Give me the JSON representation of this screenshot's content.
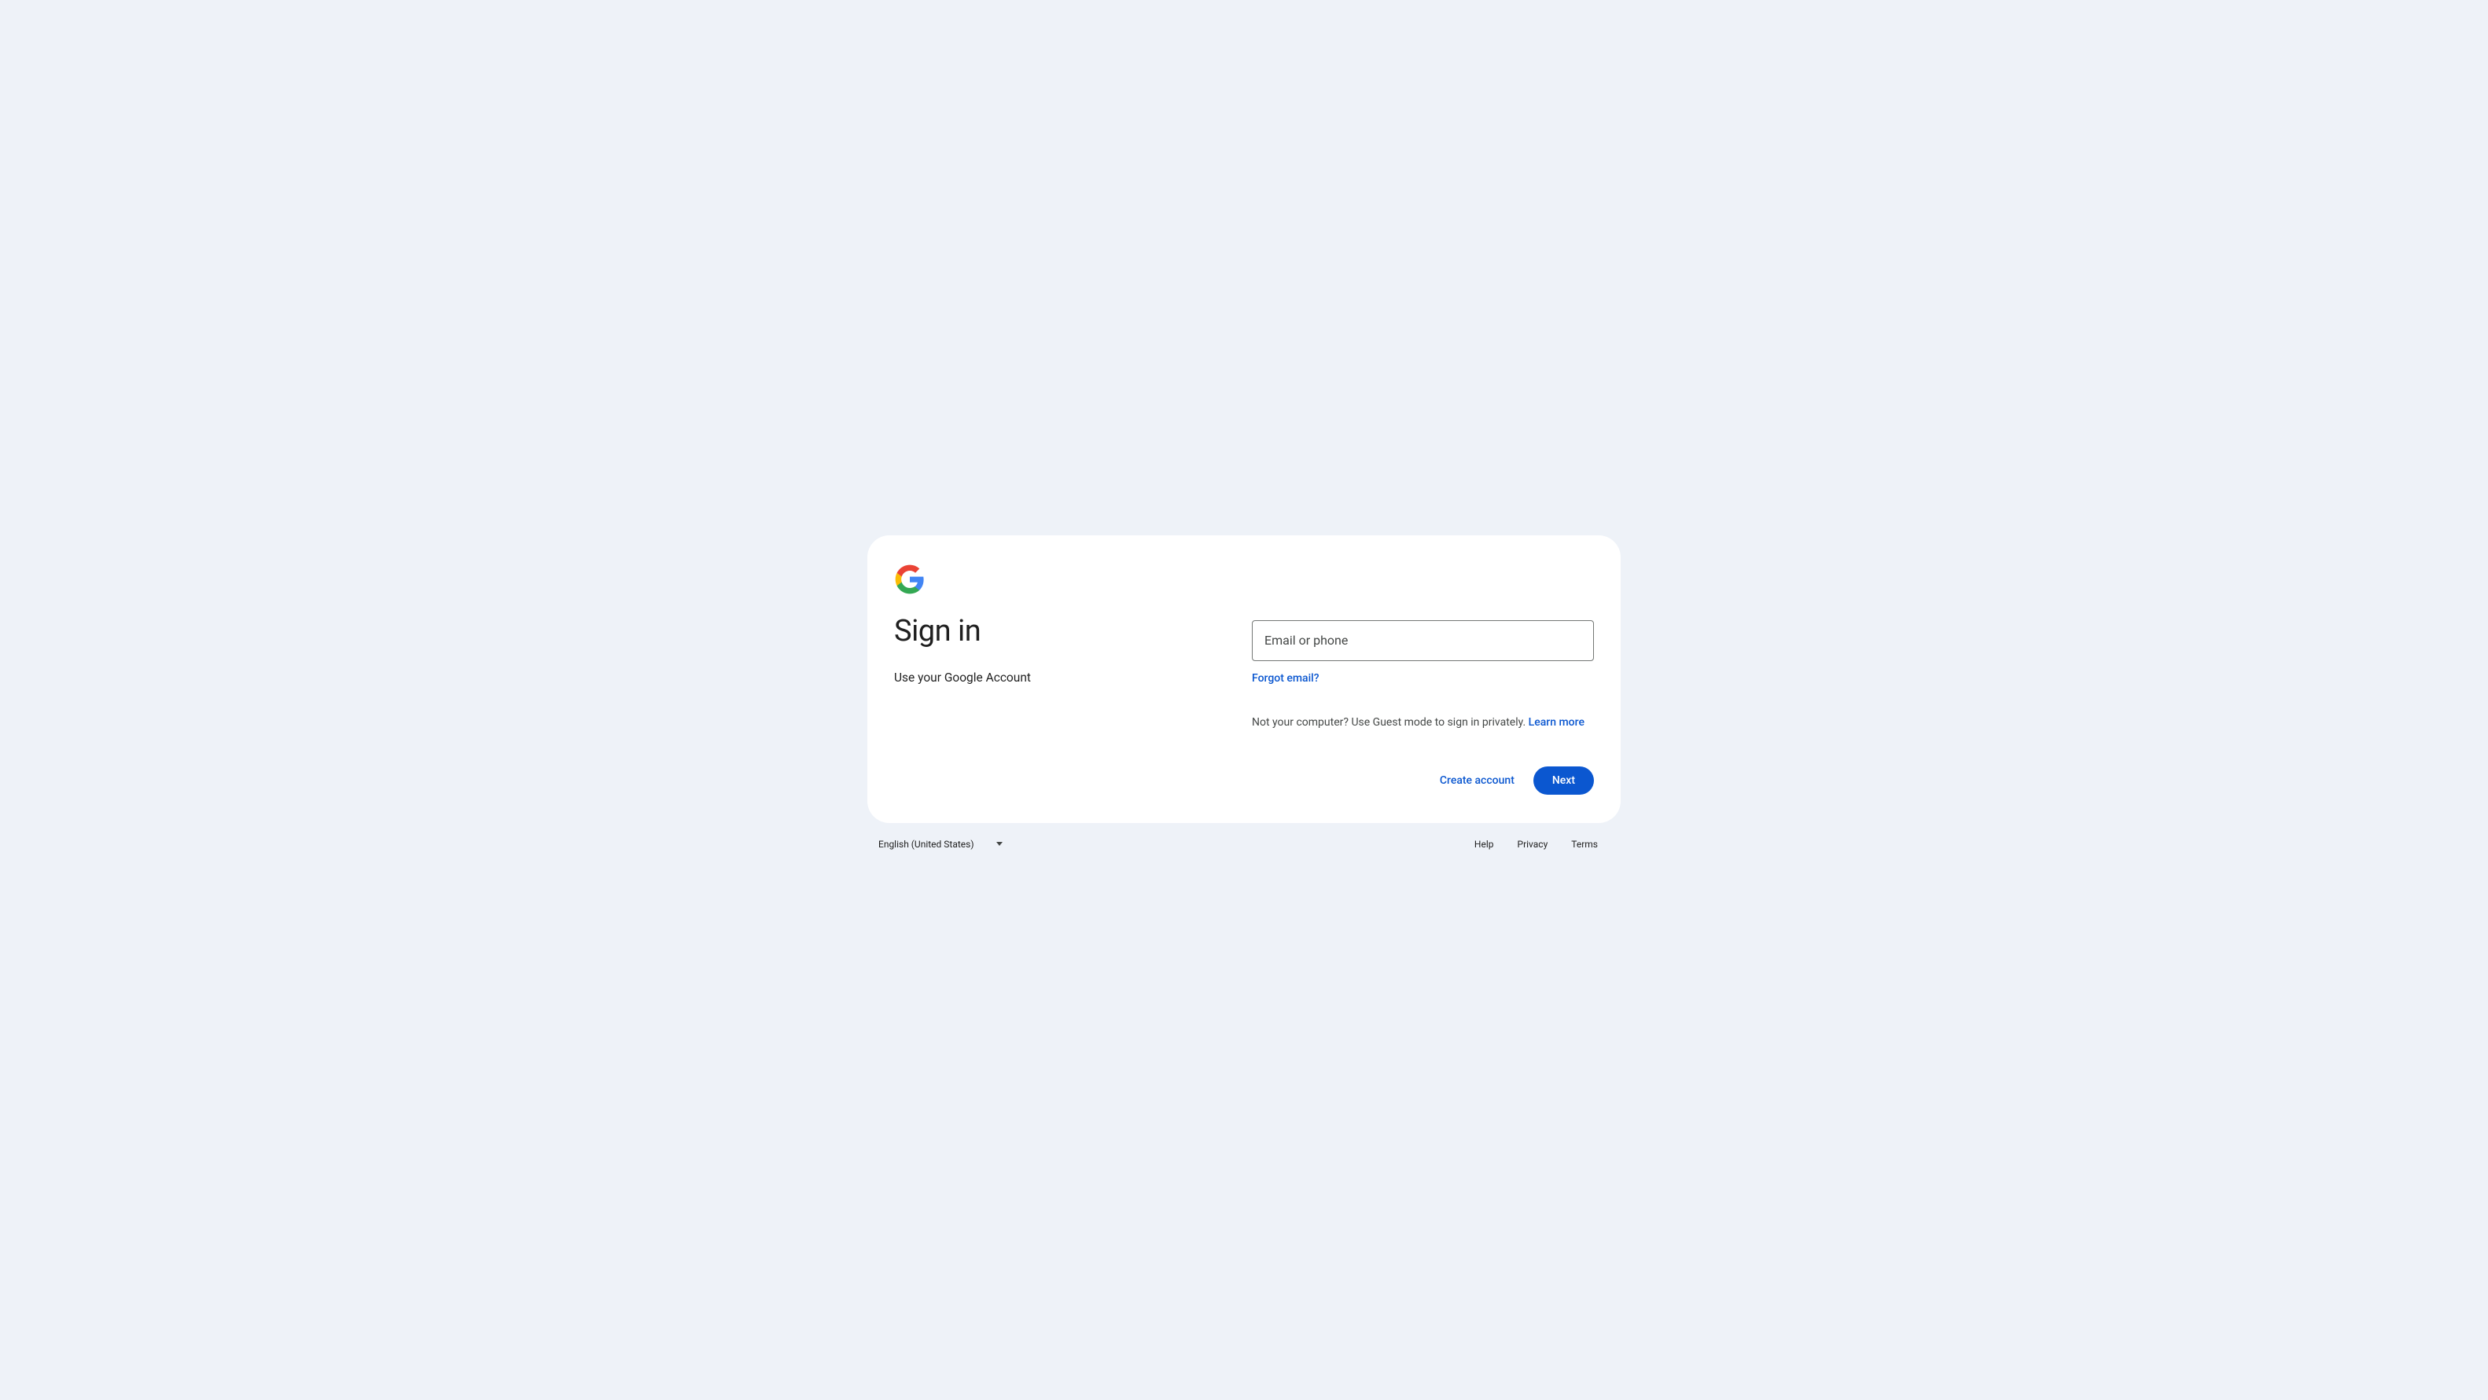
{
  "header": {
    "title": "Sign in",
    "subtitle": "Use your Google Account"
  },
  "form": {
    "email_placeholder": "Email or phone",
    "forgot_email": "Forgot email?",
    "guest_text": "Not your computer? Use Guest mode to sign in privately. ",
    "learn_more": "Learn more"
  },
  "buttons": {
    "create_account": "Create account",
    "next": "Next"
  },
  "footer": {
    "language": "English (United States)",
    "links": {
      "help": "Help",
      "privacy": "Privacy",
      "terms": "Terms"
    }
  }
}
